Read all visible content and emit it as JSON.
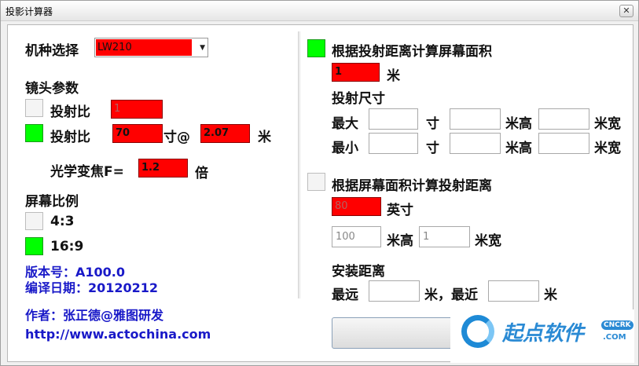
{
  "window": {
    "title": "投影计算器",
    "close_glyph": "✕"
  },
  "left": {
    "model_label": "机种选择",
    "model_value": "LW210",
    "lens_heading": "镜头参数",
    "throw_ratio_label_1": "投射比",
    "throw_ratio_value_1": "1",
    "throw_ratio_label_2": "投射比",
    "throw_ratio_value_2": "70",
    "inch_at": "寸@",
    "throw_distance_value": "2.07",
    "meter_unit": "米",
    "zoom_label": "光学变焦F=",
    "zoom_value": "1.2",
    "zoom_unit": "倍",
    "screen_ratio_heading": "屏幕比例",
    "ratio_4_3": "4:3",
    "ratio_16_9": "16:9",
    "version": "版本号：A100.0",
    "compile_date": "编译日期：20120212",
    "author": "作者：张正德@雅图研发",
    "url": "http://www.actochina.com"
  },
  "right": {
    "by_distance_heading": "根据投射距离计算屏幕面积",
    "distance_value": "1",
    "distance_unit": "米",
    "projection_size_heading": "投射尺寸",
    "max_label": "最大",
    "min_label": "最小",
    "inch_unit": "寸",
    "meter_height": "米高",
    "meter_width": "米宽",
    "by_area_heading": "根据屏幕面积计算投射距离",
    "area_value": "80",
    "area_unit": "英寸",
    "height_value": "100",
    "height_unit": "米高",
    "width_value": "1",
    "width_unit": "米宽",
    "install_heading": "安装距离",
    "farthest_label": "最远",
    "farthest_unit": "米，最近",
    "nearest_unit": "米"
  },
  "checkboxes": {
    "throw_ratio_1": false,
    "throw_ratio_2": true,
    "ratio_4_3": false,
    "ratio_16_9": true,
    "by_distance": true,
    "by_area": false
  },
  "colors": {
    "active": "#00ff00",
    "input_red": "#ff0000",
    "link_blue": "#1919c8"
  },
  "watermark": {
    "text": "起点软件",
    "badge": "CNCRK",
    "domain": ".COM"
  }
}
